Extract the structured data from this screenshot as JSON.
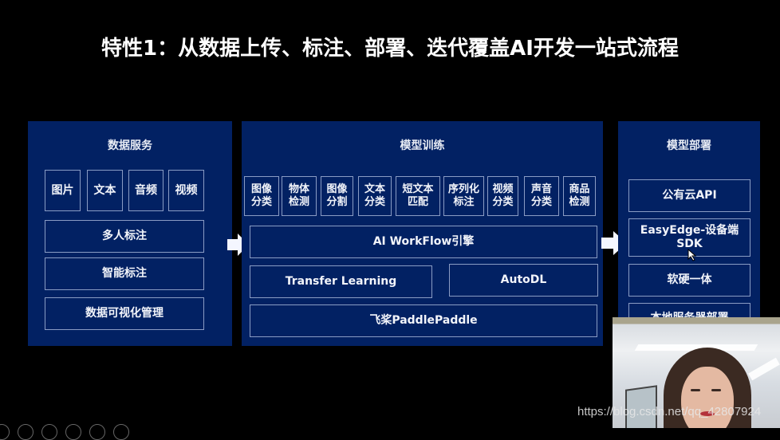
{
  "slide": {
    "title": "特性1：从数据上传、标注、部署、迭代覆盖AI开发一站式流程"
  },
  "panels": {
    "data_service": {
      "title": "数据服务",
      "types": [
        "图片",
        "文本",
        "音频",
        "视频"
      ],
      "rows": [
        "多人标注",
        "智能标注",
        "数据可视化管理"
      ]
    },
    "model_training": {
      "title": "模型训练",
      "tasks": [
        {
          "line1": "图像",
          "line2": "分类"
        },
        {
          "line1": "物体",
          "line2": "检测"
        },
        {
          "line1": "图像",
          "line2": "分割"
        },
        {
          "line1": "文本",
          "line2": "分类"
        },
        {
          "line1": "短文本",
          "line2": "匹配"
        },
        {
          "line1": "序列化",
          "line2": "标注"
        },
        {
          "line1": "视频",
          "line2": "分类"
        },
        {
          "line1": "声音",
          "line2": "分类"
        },
        {
          "line1": "商品",
          "line2": "检测"
        }
      ],
      "workflow": "AI WorkFlow引擎",
      "transfer_learning": "Transfer Learning",
      "autodl": "AutoDL",
      "framework": "飞桨PaddlePaddle"
    },
    "model_deploy": {
      "title": "模型部署",
      "items": [
        "公有云API",
        "EasyEdge-设备端",
        "SDK",
        "软硬一体",
        "本地服务器部署"
      ]
    }
  },
  "colors": {
    "background": "#000000",
    "panel": "#022163",
    "box_border": "#8a9cc4",
    "text": "#ffffff"
  },
  "overlay": {
    "watermark": "https://blog.csdn.net/qq_42807924"
  }
}
